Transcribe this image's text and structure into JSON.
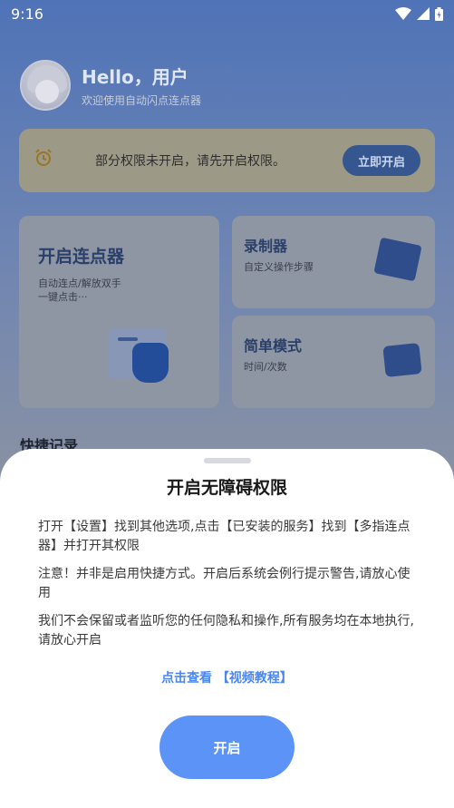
{
  "status_bar": {
    "time": "9:16"
  },
  "header": {
    "greeting": "Hello，用户",
    "subtitle": "欢迎使用自动闪点连点器"
  },
  "permission_banner": {
    "message": "部分权限未开启，请先开启权限。",
    "button_label": "立即开启"
  },
  "cards": {
    "main": {
      "title": "开启连点器",
      "desc_line1": "自动连点/解放双手",
      "desc_line2": "一键点击···"
    },
    "recorder": {
      "title": "录制器",
      "desc": "自定义操作步骤"
    },
    "simple": {
      "title": "简单模式",
      "desc": "时间/次数"
    }
  },
  "quick_section_title": "快捷记录",
  "dialog": {
    "title": "开启无障碍权限",
    "paragraph1": "打开【设置】找到其他选项,点击【已安装的服务】找到【多指连点器】并打开其权限",
    "paragraph2": "注意！并非是启用快捷方式。开启后系统会例行提示警告,请放心使用",
    "paragraph3": "我们不会保留或者监听您的任何隐私和操作,所有服务均在本地执行,请放心开启",
    "tutorial_link": "点击查看 【视频教程】",
    "confirm_label": "开启"
  },
  "colors": {
    "accent": "#5b93f7",
    "link": "#4b86f0",
    "overlay_banner": "#9c9a86"
  }
}
